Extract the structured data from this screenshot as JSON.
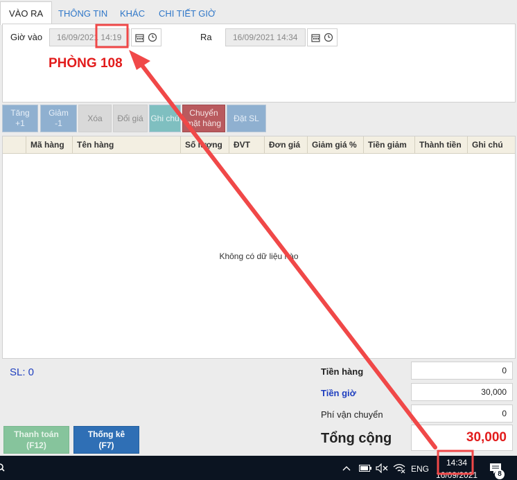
{
  "tabs": [
    "VÀO RA",
    "THÔNG TIN",
    "KHÁC",
    "CHI TIẾT GIỜ"
  ],
  "time_in": {
    "label": "Giờ vào",
    "value": "16/09/2021 14:19"
  },
  "time_out": {
    "label": "Ra",
    "value": "16/09/2021 14:34"
  },
  "room_label": "PHÒNG 108",
  "toolbar": {
    "inc": [
      "Tăng",
      "+1"
    ],
    "dec": [
      "Giảm",
      "-1"
    ],
    "delete": "Xóa",
    "change_price": "Đổi giá",
    "note": "Ghi chú",
    "move": [
      "Chuyển",
      "mặt hàng"
    ],
    "set_qty": "Đặt SL"
  },
  "grid": {
    "columns": [
      "Mã hàng",
      "Tên hàng",
      "Số lượng",
      "ĐVT",
      "Đơn giá",
      "Giảm giá %",
      "Tiền giảm",
      "Thành tiền",
      "Ghi chú"
    ],
    "empty_text": "Không có dữ liệu nào"
  },
  "summary": {
    "sl": "SL: 0",
    "tien_hang_label": "Tiền hàng",
    "tien_hang": "0",
    "tien_gio_label": "Tiền giờ",
    "tien_gio": "30,000",
    "phi_vc_label": "Phí vận chuyển",
    "phi_vc": "0",
    "total_label": "Tổng cộng",
    "total": "30,000"
  },
  "buttons": {
    "pay": [
      "Thanh toán",
      "(F12)"
    ],
    "stats": [
      "Thống kê",
      "(F7)"
    ]
  },
  "taskbar": {
    "lang": "ENG",
    "time": "14:34",
    "date": "16/09/2021",
    "notif_count": "8"
  },
  "colors": {
    "accent_red": "#e21c1c",
    "tab_blue": "#2f77c8",
    "stats_button": "#2f6fb5",
    "pay_button": "#86c49c"
  }
}
